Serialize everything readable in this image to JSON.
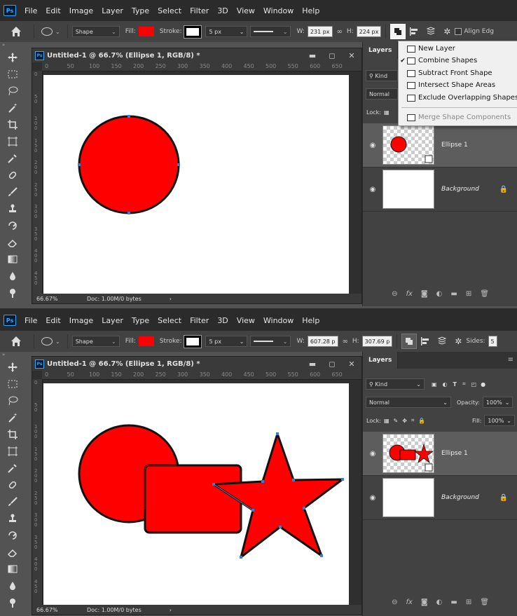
{
  "app": {
    "logo": "Ps",
    "menu": [
      "File",
      "Edit",
      "Image",
      "Layer",
      "Type",
      "Select",
      "Filter",
      "3D",
      "View",
      "Window",
      "Help"
    ]
  },
  "top": {
    "options": {
      "mode": "Shape",
      "fill_label": "Fill:",
      "fill_color": "#ff0000",
      "stroke_label": "Stroke:",
      "stroke_width": "5 px",
      "w_label": "W:",
      "w_value": "231 px",
      "h_label": "H:",
      "h_value": "224 px",
      "align_edges_label": "Align Edg"
    },
    "document": {
      "title": "Untitled-1 @ 66.7% (Ellipse 1, RGB/8) *",
      "zoom": "66.67%",
      "doc_info": "Doc: 1.00M/0 bytes",
      "ruler_h": [
        "0",
        "50",
        "100",
        "150",
        "200",
        "250",
        "300",
        "350",
        "400",
        "450",
        "500",
        "550",
        "600",
        "650"
      ],
      "ruler_v": [
        "0",
        "50",
        "100",
        "150",
        "200",
        "250",
        "300",
        "350",
        "400",
        "450"
      ]
    },
    "layers_panel": {
      "tab": "Layers",
      "kind": "Kind",
      "blend": "Normal",
      "lock_label": "Lock:",
      "layers": [
        {
          "name": "Ellipse 1",
          "selected": true
        },
        {
          "name": "Background",
          "selected": false
        }
      ]
    },
    "path_ops_menu": {
      "items": [
        {
          "label": "New Layer",
          "checked": false,
          "disabled": false
        },
        {
          "label": "Combine Shapes",
          "checked": true,
          "disabled": false
        },
        {
          "label": "Subtract Front Shape",
          "checked": false,
          "disabled": false
        },
        {
          "label": "Intersect Shape Areas",
          "checked": false,
          "disabled": false
        },
        {
          "label": "Exclude Overlapping Shapes",
          "checked": false,
          "disabled": false
        },
        {
          "label": "Merge Shape Components",
          "checked": false,
          "disabled": true
        }
      ]
    }
  },
  "bottom": {
    "options": {
      "mode": "Shape",
      "fill_label": "Fill:",
      "fill_color": "#ff0000",
      "stroke_label": "Stroke:",
      "stroke_width": "5 px",
      "w_label": "W:",
      "w_value": "607.28 p",
      "h_label": "H:",
      "h_value": "307.69 p",
      "sides_label": "Sides:",
      "sides_value": "5"
    },
    "document": {
      "title": "Untitled-1 @ 66.7% (Ellipse 1, RGB/8) *",
      "zoom": "66.67%",
      "doc_info": "Doc: 1.00M/0 bytes",
      "ruler_h": [
        "0",
        "50",
        "100",
        "150",
        "200",
        "250",
        "300",
        "350",
        "400",
        "450",
        "500",
        "550",
        "600",
        "650"
      ],
      "ruler_v": [
        "0",
        "50",
        "100",
        "150",
        "200",
        "250",
        "300",
        "350",
        "400",
        "450"
      ]
    },
    "layers_panel": {
      "tab": "Layers",
      "kind": "Kind",
      "blend": "Normal",
      "opacity_label": "Opacity:",
      "opacity_value": "100%",
      "lock_label": "Lock:",
      "fill_label": "Fill:",
      "fill_value": "100%",
      "layers": [
        {
          "name": "Ellipse 1",
          "selected": true
        },
        {
          "name": "Background",
          "selected": false
        }
      ]
    }
  },
  "colors": {
    "shape_fill": "#ff0000",
    "shape_stroke": "#111111",
    "handle": "#3a7bd5",
    "accent": "#31a8ff"
  }
}
